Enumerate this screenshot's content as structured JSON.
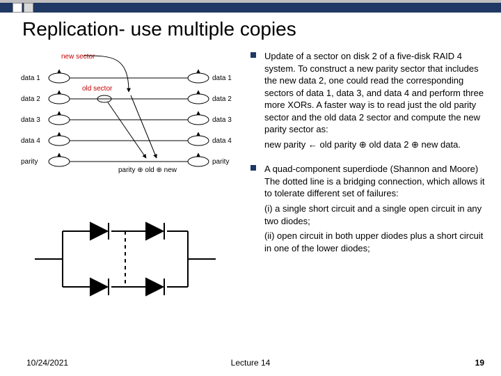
{
  "title": "Replication- use multiple copies",
  "bullets": [
    {
      "main": "Update of a sector on disk 2 of a five-disk RAID 4 system. To construct a new parity sector that includes the new data 2, one could read the corresponding sectors of data 1, data 3, and data 4 and perform three more XORs. A faster way is to read just the old parity sector and the old data 2 sector and compute the new parity sector as:",
      "sub": "new parity ← old parity ⊕ old data 2 ⊕ new data."
    },
    {
      "main": "A quad-component superdiode (Shannon and Moore)  The dotted line is a bridging connection, which allows it to tolerate different set of failures:",
      "sub1": "(i) a single short circuit and a single open circuit in any two diodes;",
      "sub2": "(ii) open circuit in both upper diodes plus a short circuit in one of the lower diodes;"
    }
  ],
  "raid_labels": {
    "new_sector": "new sector",
    "old_sector": "old sector",
    "rows": [
      "data 1",
      "data 2",
      "data 3",
      "data 4",
      "parity"
    ],
    "parity_formula": "parity ⊕ old ⊕ new"
  },
  "footer": {
    "date": "10/24/2021",
    "center": "Lecture 14",
    "page": "19"
  }
}
